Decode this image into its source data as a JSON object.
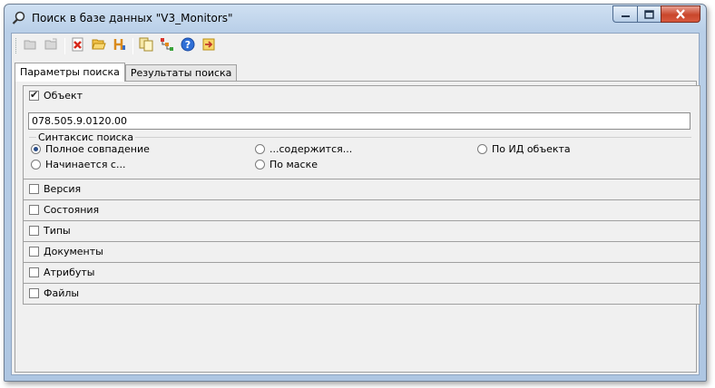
{
  "window": {
    "title": "Поиск в базе данных \"V3_Monitors\""
  },
  "toolbar": {
    "buttons": [
      {
        "icon": "open-folder-icon"
      },
      {
        "icon": "save-icon"
      },
      {
        "icon": "delete-icon"
      },
      {
        "icon": "folder-open-icon"
      },
      {
        "icon": "bracket-icon"
      },
      {
        "icon": "copy-icon"
      },
      {
        "icon": "tree-icon"
      },
      {
        "icon": "help-icon"
      },
      {
        "icon": "exit-icon"
      }
    ]
  },
  "tabs": [
    {
      "label": "Параметры поиска",
      "active": true
    },
    {
      "label": "Результаты поиска",
      "active": false
    }
  ],
  "object_section": {
    "label": "Объект",
    "checked": true,
    "value": "078.505.9.0120.00",
    "syntax": {
      "legend": "Синтаксис поиска",
      "options": [
        {
          "label": "Полное совпадение",
          "selected": true
        },
        {
          "label": "...содержится...",
          "selected": false
        },
        {
          "label": "По ИД объекта",
          "selected": false
        },
        {
          "label": "Начинается с...",
          "selected": false
        },
        {
          "label": "По маске",
          "selected": false
        }
      ]
    }
  },
  "sections": [
    {
      "label": "Версия",
      "checked": false
    },
    {
      "label": "Состояния",
      "checked": false
    },
    {
      "label": "Типы",
      "checked": false
    },
    {
      "label": "Документы",
      "checked": false
    },
    {
      "label": "Атрибуты",
      "checked": false
    },
    {
      "label": "Файлы",
      "checked": false
    }
  ]
}
